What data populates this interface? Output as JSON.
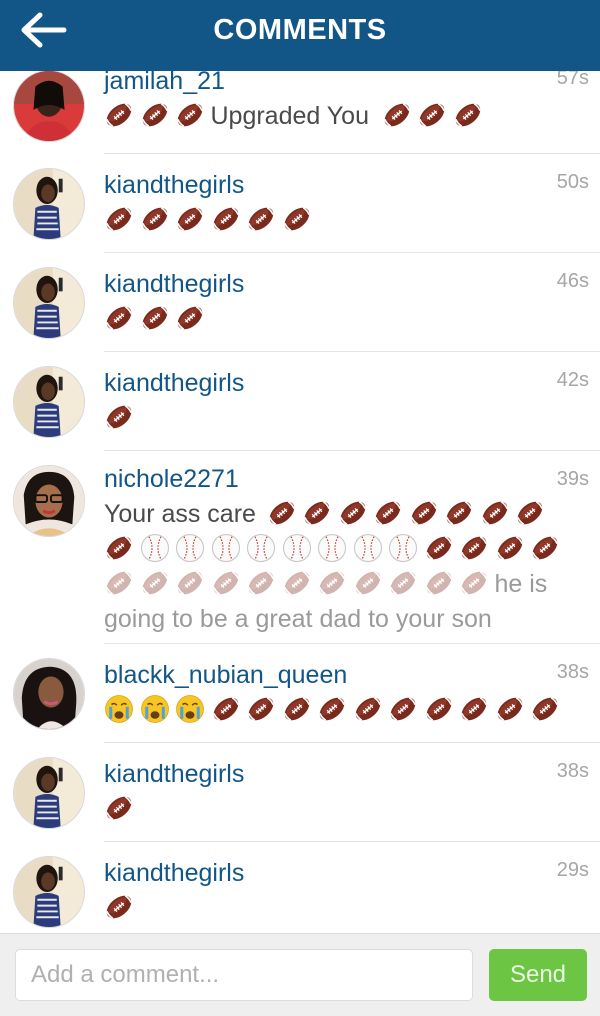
{
  "header": {
    "title": "COMMENTS",
    "back_icon": "back-arrow-icon"
  },
  "icons": {
    "football": "american-football-emoji",
    "baseball": "baseball-emoji",
    "crying": "loudly-crying-face-emoji"
  },
  "colors": {
    "header_bg": "#125688",
    "username": "#125688",
    "send_button": "#6cc644"
  },
  "comments": [
    {
      "username": "jamilah_21",
      "time": "57s",
      "text_before": "",
      "text_mid": "Upgraded You",
      "text_after": ""
    },
    {
      "username": "kiandthegirls",
      "time": "50s"
    },
    {
      "username": "kiandthegirls",
      "time": "46s"
    },
    {
      "username": "kiandthegirls",
      "time": "42s"
    },
    {
      "username": "nichole2271",
      "time": "39s",
      "text_before": "Your ass care",
      "text_after_inline": "he is",
      "text_last": "going to be a great dad to your son"
    },
    {
      "username": "blackk_nubian_queen",
      "time": "38s"
    },
    {
      "username": "kiandthegirls",
      "time": "38s"
    },
    {
      "username": "kiandthegirls",
      "time": "29s"
    }
  ],
  "footer": {
    "input_placeholder": "Add a comment...",
    "input_value": "",
    "send_label": "Send"
  }
}
